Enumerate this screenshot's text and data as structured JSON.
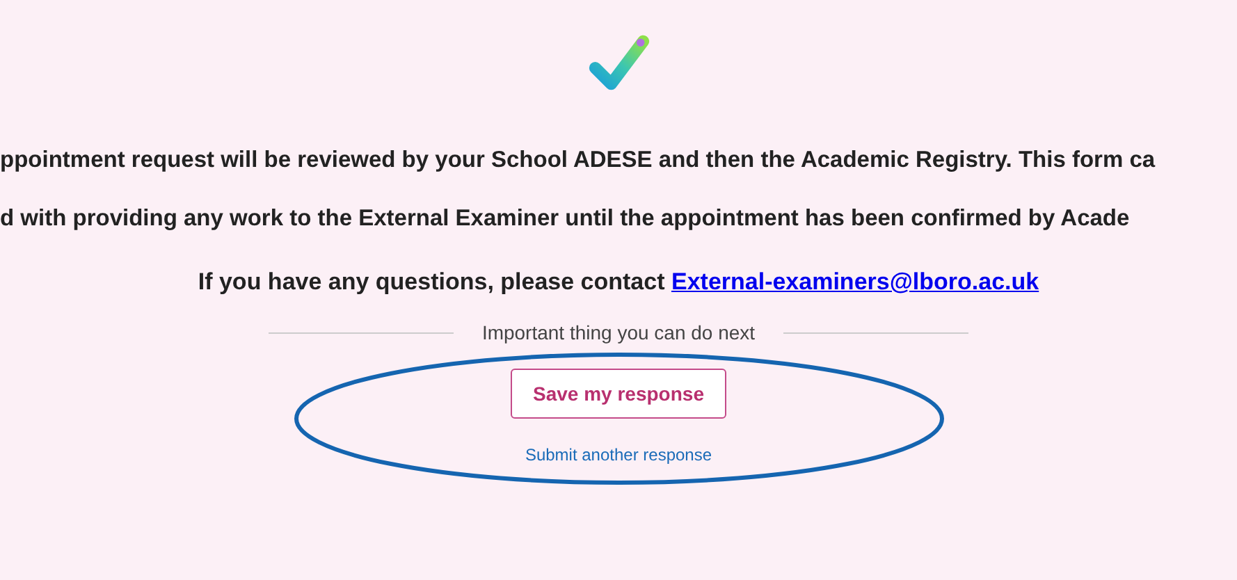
{
  "messages": [
    "ppointment request will be reviewed by your School ADESE and then the Academic Registry. This form ca",
    "d with providing any work to the External Examiner until the appointment has been confirmed by Acade"
  ],
  "contact": {
    "text": "If you have any questions, please contact",
    "link": "External-examiners@lboro.ac.uk"
  },
  "next_heading": "Important thing you can do next",
  "save_button": "Save my response",
  "submit_link": "Submit another response"
}
